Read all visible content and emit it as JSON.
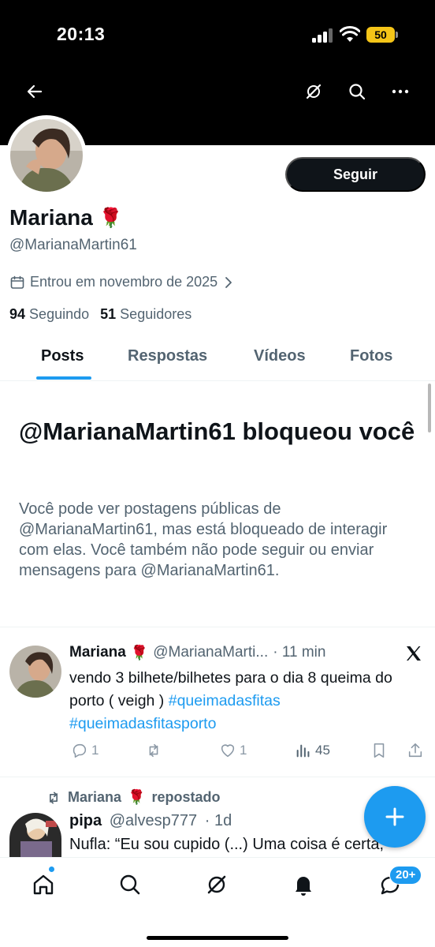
{
  "status_bar": {
    "time": "20:13",
    "battery": "50"
  },
  "profile": {
    "name": "Mariana",
    "name_emoji": "🌹",
    "handle": "@MarianaMartin61",
    "joined": "Entrou em novembro de 2025",
    "follow_button": "Seguir",
    "following_count": "94",
    "following_label": "Seguindo",
    "followers_count": "51",
    "followers_label": "Seguidores"
  },
  "tabs": [
    {
      "label": "Posts",
      "active": true
    },
    {
      "label": "Respostas",
      "active": false
    },
    {
      "label": "Vídeos",
      "active": false
    },
    {
      "label": "Fotos",
      "active": false
    }
  ],
  "blocked": {
    "title": "@MarianaMartin61 bloqueou você",
    "message": "Você pode ver postagens públicas de @MarianaMartin61, mas está bloqueado de interagir com elas. Você também não pode seguir ou enviar mensagens para @MarianaMartin61."
  },
  "tweets": [
    {
      "name": "Mariana",
      "emoji": "🌹",
      "handle": "@MarianaMarti...",
      "time": "· 11 min",
      "text": "vendo 3 bilhete/bilhetes para o dia 8 queima do porto ( veigh )",
      "hashtags": [
        "#queimadasfitas",
        "#queimadasfitasporto"
      ],
      "replies": "1",
      "reposts": "",
      "likes": "1",
      "views": "45"
    },
    {
      "reposted_by": "Mariana",
      "reposted_emoji": "🌹",
      "reposted_label": "repostado",
      "name": "pipa",
      "handle": "@alvesp777",
      "time": "· 1d",
      "text": "Nufla: “Eu sou cupido (...) Uma coisa é certa,"
    }
  ],
  "bottom_nav": {
    "messages_badge": "20+"
  },
  "icons": [
    "back-arrow-icon",
    "grok-icon",
    "search-icon",
    "more-icon",
    "calendar-icon",
    "chevron-right-icon",
    "x-logo-icon",
    "reply-icon",
    "repost-icon",
    "like-icon",
    "views-icon",
    "bookmark-icon",
    "share-icon",
    "plus-icon",
    "home-icon",
    "bell-icon",
    "messages-icon"
  ],
  "colors": {
    "accent": "#1d9bf0",
    "text": "#0f1419",
    "muted": "#536471",
    "header": "#000000"
  }
}
